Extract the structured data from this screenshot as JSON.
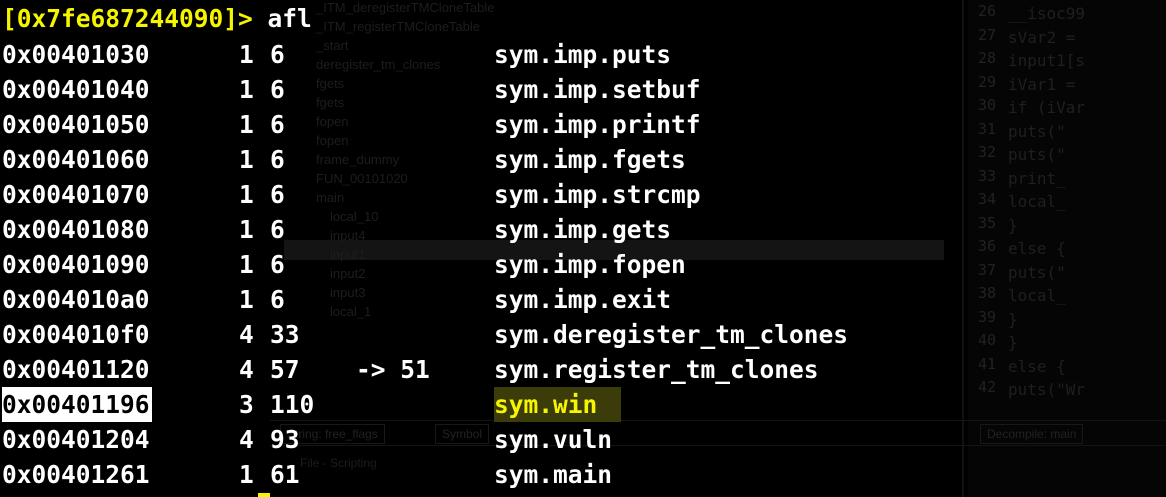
{
  "prompt": {
    "address": "[0x7fe687244090]>",
    "command": "afl"
  },
  "rows": [
    {
      "addr": "0x00401030",
      "bbs": "1",
      "size": "6",
      "arrow": "",
      "name": "sym.imp.puts"
    },
    {
      "addr": "0x00401040",
      "bbs": "1",
      "size": "6",
      "arrow": "",
      "name": "sym.imp.setbuf"
    },
    {
      "addr": "0x00401050",
      "bbs": "1",
      "size": "6",
      "arrow": "",
      "name": "sym.imp.printf"
    },
    {
      "addr": "0x00401060",
      "bbs": "1",
      "size": "6",
      "arrow": "",
      "name": "sym.imp.fgets"
    },
    {
      "addr": "0x00401070",
      "bbs": "1",
      "size": "6",
      "arrow": "",
      "name": "sym.imp.strcmp"
    },
    {
      "addr": "0x00401080",
      "bbs": "1",
      "size": "6",
      "arrow": "",
      "name": "sym.imp.gets"
    },
    {
      "addr": "0x00401090",
      "bbs": "1",
      "size": "6",
      "arrow": "",
      "name": "sym.imp.fopen"
    },
    {
      "addr": "0x004010a0",
      "bbs": "1",
      "size": "6",
      "arrow": "",
      "name": "sym.imp.exit"
    },
    {
      "addr": "0x004010f0",
      "bbs": "4",
      "size": "33",
      "arrow": "",
      "name": "sym.deregister_tm_clones"
    },
    {
      "addr": "0x00401120",
      "bbs": "4",
      "size": "57",
      "arrow": "-> 51",
      "name": "sym.register_tm_clones"
    },
    {
      "addr": "0x00401196",
      "bbs": "3",
      "size": "110",
      "arrow": "",
      "name": "sym.win"
    },
    {
      "addr": "0x00401204",
      "bbs": "4",
      "size": "93",
      "arrow": "",
      "name": "sym.vuln"
    },
    {
      "addr": "0x00401261",
      "bbs": "1",
      "size": "61",
      "arrow": "",
      "name": "sym.main"
    }
  ],
  "highlight": {
    "row_index": 10,
    "addr_bg": "#ffffff",
    "name_color": "#f5f500",
    "name_bg": "#3c3c0a"
  },
  "colors": {
    "background": "#000000",
    "text": "#ffffff",
    "prompt": "#f5f500"
  },
  "background_app": {
    "tree_items": [
      "_ITM_deregisterTMCloneTable",
      "_ITM_registerTMCloneTable",
      "_start",
      "deregister_tm_clones",
      "fgets",
      "fgets",
      "fopen",
      "fopen",
      "frame_dummy",
      "FUN_00101020",
      "main",
      "local_10",
      "input4",
      "input1",
      "input2",
      "input3",
      "local_1"
    ],
    "line_numbers": [
      "26",
      "27",
      "28",
      "29",
      "30",
      "31",
      "32",
      "33",
      "34",
      "35",
      "36",
      "37",
      "38",
      "39",
      "40",
      "41",
      "42"
    ],
    "code_lines": [
      "__isoc99",
      "sVar2 =",
      "input1[s",
      "iVar1 =",
      "if (iVar",
      "  puts(\"",
      "  puts(\"",
      "  print_",
      "  local_",
      "}",
      "else {",
      "  puts(\"",
      "  local_",
      "}",
      "}",
      "else {",
      "  puts(\"Wr"
    ],
    "tabs": [
      "String: free_flags",
      "Symbol",
      "Decompile: main"
    ],
    "status": "File - Scripting"
  }
}
